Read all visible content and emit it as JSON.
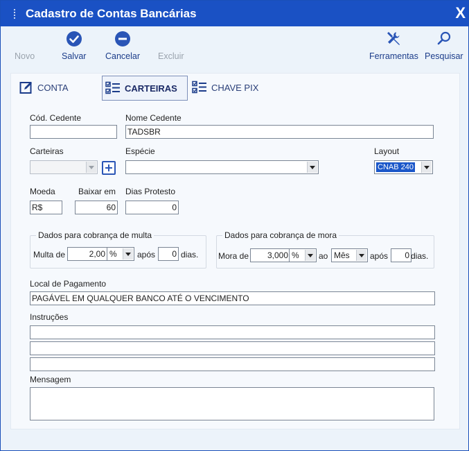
{
  "window": {
    "title": "Cadastro de Contas Bancárias",
    "close_label": "X"
  },
  "toolbar": {
    "novo": "Novo",
    "salvar": "Salvar",
    "cancelar": "Cancelar",
    "excluir": "Excluir",
    "ferramentas": "Ferramentas",
    "pesquisar": "Pesquisar"
  },
  "tabs": {
    "conta": "CONTA",
    "carteiras": "CARTEIRAS",
    "chave_pix": "CHAVE PIX"
  },
  "form": {
    "cod_cedente_label": "Cód. Cedente",
    "cod_cedente_value": "",
    "nome_cedente_label": "Nome Cedente",
    "nome_cedente_value": "TADSBR",
    "carteiras_label": "Carteiras",
    "carteiras_value": "",
    "especie_label": "Espécie",
    "especie_value": "",
    "layout_label": "Layout",
    "layout_value": "CNAB 240",
    "moeda_label": "Moeda",
    "moeda_value": "R$",
    "baixar_em_label": "Baixar em",
    "baixar_em_value": "60",
    "dias_protesto_label": "Dias Protesto",
    "dias_protesto_value": "0"
  },
  "multa": {
    "legend": "Dados para cobrança de multa",
    "label": "Multa de",
    "value": "2,00",
    "unit": "%",
    "apos": "após",
    "days": "0",
    "dias": "dias."
  },
  "mora": {
    "legend": "Dados para cobrança de mora",
    "label": "Mora de",
    "value": "3,000",
    "unit": "%",
    "ao": "ao",
    "period": "Mês",
    "apos": "após",
    "days": "0",
    "dias": "dias."
  },
  "local": {
    "label": "Local de Pagamento",
    "value": "PAGÁVEL EM QUALQUER BANCO ATÉ O VENCIMENTO"
  },
  "instrucoes": {
    "label": "Instruções",
    "lines": [
      "",
      "",
      ""
    ]
  },
  "mensagem": {
    "label": "Mensagem",
    "value": ""
  },
  "colors": {
    "titlebar": "#1a51c4",
    "accent": "#2a55b6",
    "selection": "#1b57c9"
  }
}
